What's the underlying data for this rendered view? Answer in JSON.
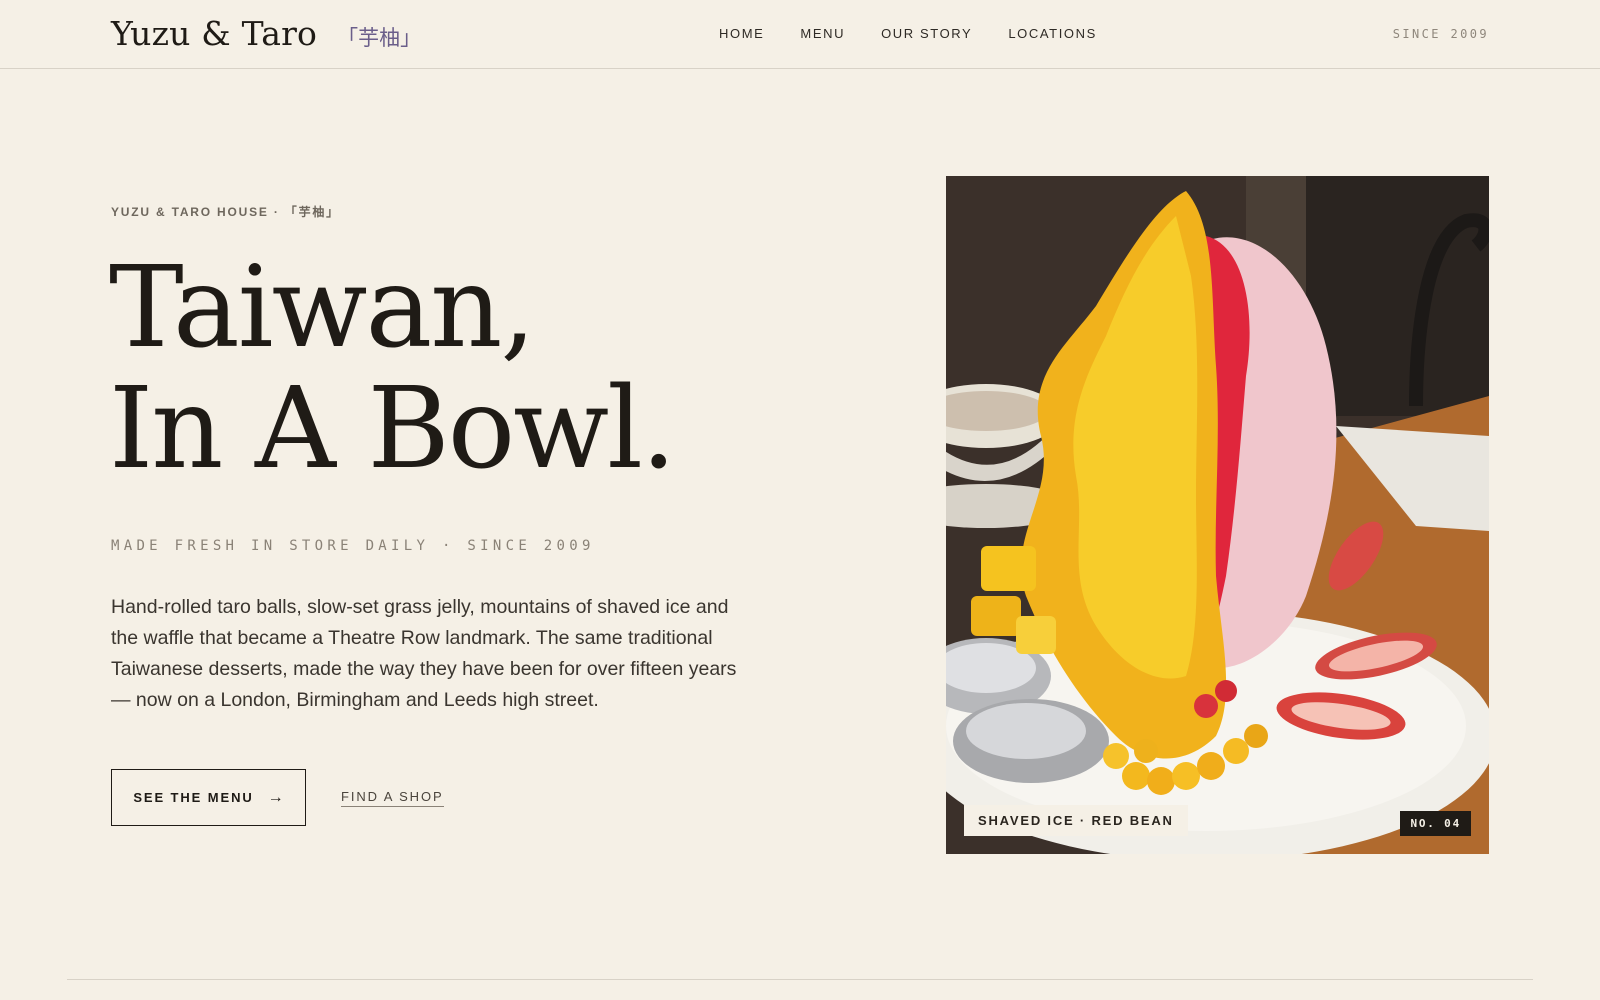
{
  "header": {
    "brand_name": "Yuzu & Taro",
    "brand_cjk": "「芋柚」",
    "nav": [
      "HOME",
      "MENU",
      "OUR STORY",
      "LOCATIONS"
    ],
    "since": "SINCE 2009"
  },
  "hero": {
    "eyebrow": "YUZU & TARO HOUSE · 「芋柚」",
    "headline_line1": "Taiwan,",
    "headline_line2": "In A Bowl.",
    "tagline": "MADE FRESH IN STORE DAILY · SINCE 2009",
    "body": "Hand-rolled taro balls, slow-set grass jelly, mountains of shaved ice and the waffle that became a Theatre Row landmark. The same traditional Taiwanese desserts, made the way they have been for over fifteen years — now on a London, Birmingham and Leeds high street.",
    "cta_primary": "SEE THE MENU",
    "cta_primary_icon": "arrow-right-icon",
    "cta_secondary": "FIND A SHOP"
  },
  "photo": {
    "caption": "SHAVED ICE · RED BEAN",
    "badge": "NO. 04"
  },
  "colors": {
    "background": "#f5f0e6",
    "ink": "#1f1b16",
    "muted": "#8a8277",
    "accent_cjk": "#6a5e8a"
  }
}
